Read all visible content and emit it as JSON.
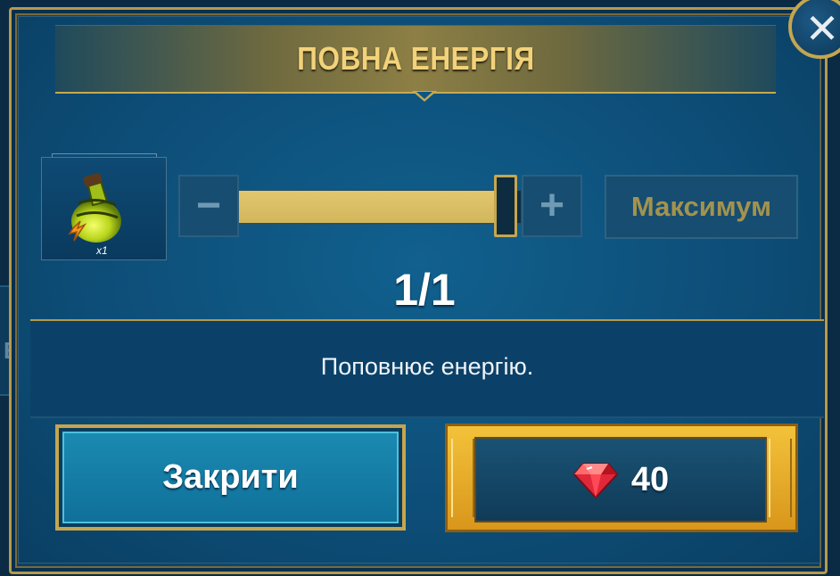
{
  "dialog": {
    "title": "ПОВНА ЕНЕРГІЯ",
    "close_icon_glyph": "✕"
  },
  "background": {
    "partial_letter": "E"
  },
  "item": {
    "name_icon": "energy-potion-icon",
    "quantity_label": "x1"
  },
  "quantity_selector": {
    "minus_label": "−",
    "plus_label": "+",
    "max_label": "Максимум",
    "selected": 1,
    "max": 1,
    "counter_text": "1/1",
    "fill_fraction": 1.0
  },
  "description": "Поповнює енергію.",
  "buttons": {
    "close_label": "Закрити",
    "price": "40",
    "currency_icon": "ruby-gem-icon"
  },
  "colors": {
    "accent_gold": "#c6a54f",
    "title_text": "#f2d27a",
    "slider_fill": "#d9bd63",
    "panel_blue": "#0f5581",
    "gem_red": "#e0283a"
  }
}
